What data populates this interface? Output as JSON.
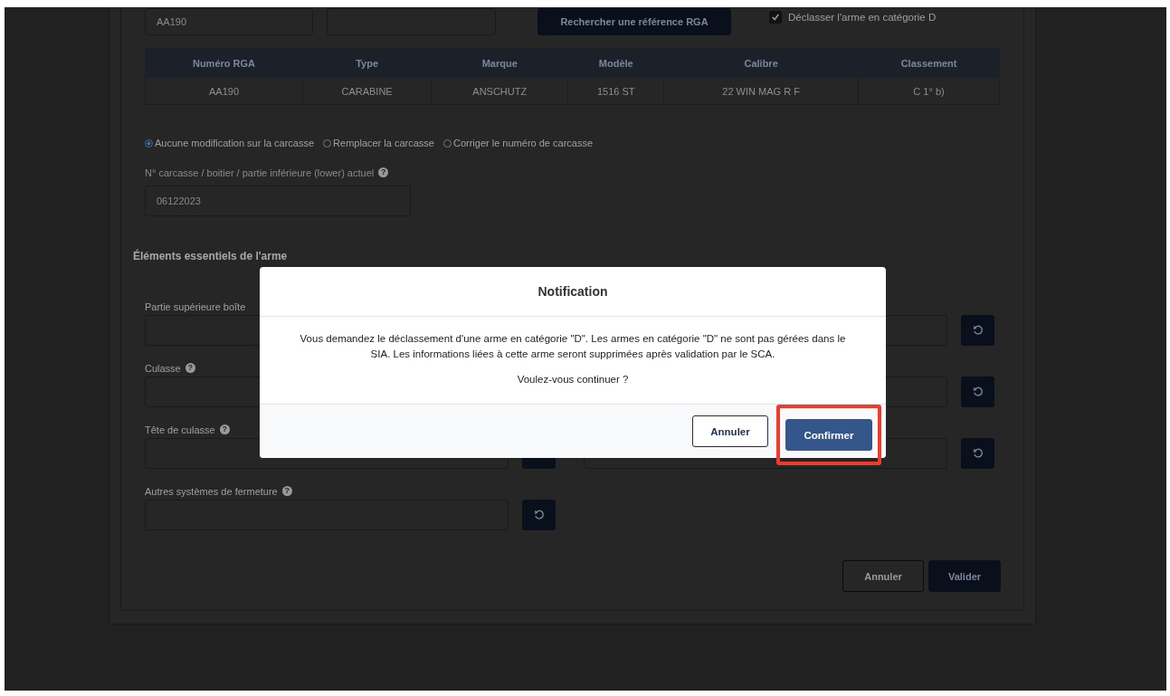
{
  "search_row": {
    "rga_field": {
      "value": "AA190"
    },
    "search_button": "Rechercher une référence RGA",
    "declass_checkbox": {
      "label": "Déclasser l'arme en catégorie D",
      "checked": true
    }
  },
  "rga_table": {
    "columns": [
      "Numéro RGA",
      "Type",
      "Marque",
      "Modèle",
      "Calibre",
      "Classement"
    ],
    "rows": [
      [
        "AA190",
        "CARABINE",
        "ANSCHUTZ",
        "1516 ST",
        "22 WIN MAG R F",
        "C 1° b)"
      ]
    ]
  },
  "frame_options": [
    {
      "label": "Aucune modification sur la carcasse",
      "selected": true
    },
    {
      "label": "Remplacer la carcasse",
      "selected": false
    },
    {
      "label": "Corriger le numéro de carcasse",
      "selected": false
    }
  ],
  "frame_number": {
    "label": "N° carcasse / boitier / partie inférieure (lower) actuel",
    "help_icon": "?",
    "value": "06122023"
  },
  "essential_elements": {
    "heading": "Éléments essentiels de l'arme",
    "fields": [
      {
        "label": "Partie supérieure boîte",
        "paired": true
      },
      {
        "label": "Culasse",
        "help_icon": "?",
        "paired": true
      },
      {
        "label": "Tête de culasse",
        "help_icon": "?",
        "paired": true
      },
      {
        "label": "Autres systèmes de fermeture",
        "help_icon": "?",
        "paired": false
      }
    ]
  },
  "form_buttons": [
    {
      "label": "Annuler",
      "kind": "secondary"
    },
    {
      "label": "Valider",
      "kind": "primary"
    }
  ],
  "modal": {
    "title": "Notification",
    "message": "Vous demandez le déclassement d'une arme en catégorie \"D\". Les armes en catégorie \"D\" ne sont pas gérées dans le SIA. Les informations liées à cette arme seront supprimées après validation par le SCA.",
    "question": "Voulez-vous continuer ?",
    "buttons": [
      {
        "label": "Annuler",
        "kind": "secondary",
        "highlighted": false
      },
      {
        "label": "Confirmer",
        "kind": "primary",
        "highlighted": true
      }
    ]
  }
}
